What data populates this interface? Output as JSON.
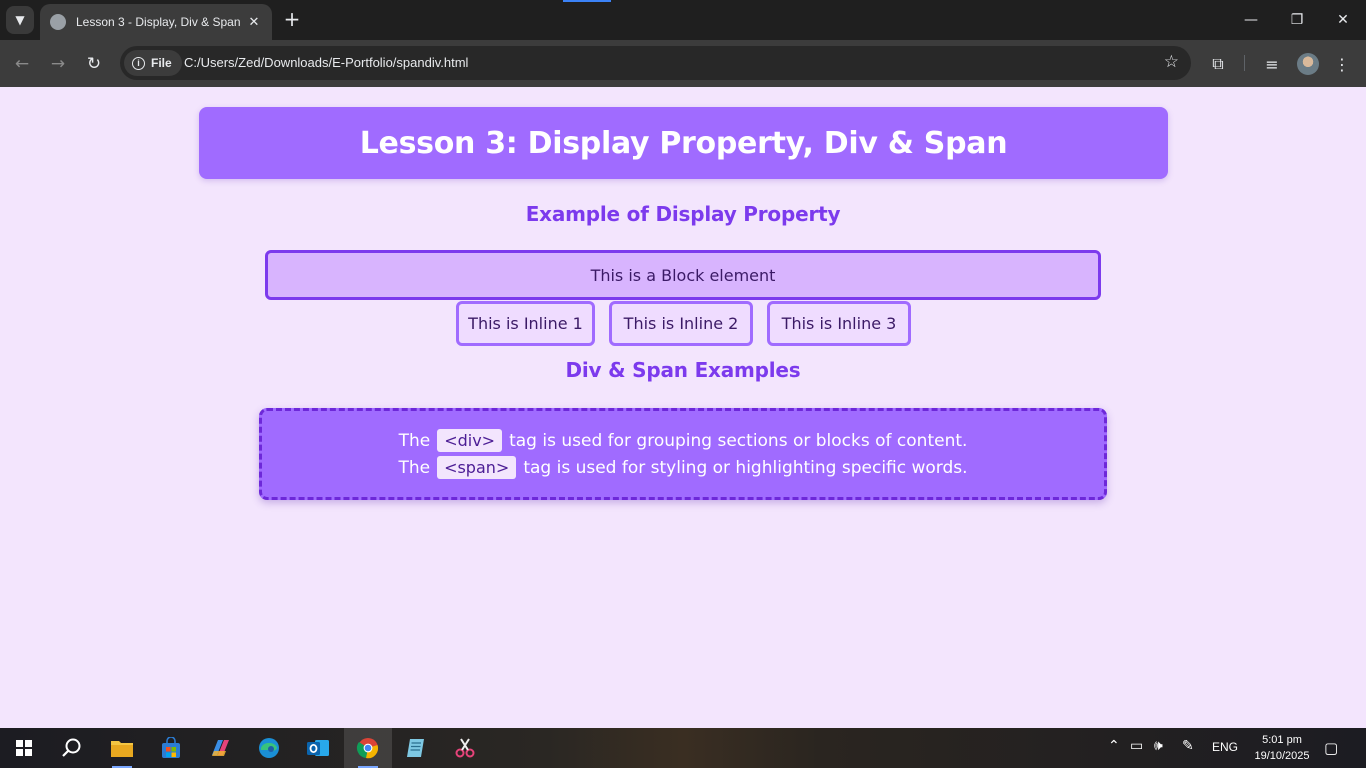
{
  "browser": {
    "tab_title": "Lesson 3 - Display, Div & Span",
    "site_chip_label": "File",
    "url": "C:/Users/Zed/Downloads/E-Portfolio/spandiv.html"
  },
  "page": {
    "title": "Lesson 3: Display Property, Div & Span",
    "section1_heading": "Example of Display Property",
    "block_element_text": "This is a Block element",
    "inline_elements": [
      "This is Inline 1",
      "This is Inline 2",
      "This is Inline 3"
    ],
    "section2_heading": "Div & Span Examples",
    "div_line": {
      "prefix": "The",
      "code": "<div>",
      "suffix": "tag is used for grouping sections or blocks of content."
    },
    "span_line": {
      "prefix": "The",
      "code": "<span>",
      "suffix": "tag is used for styling or highlighting specific words."
    }
  },
  "taskbar": {
    "apps": [
      "start",
      "search",
      "file-explorer",
      "microsoft-store",
      "copilot",
      "edge",
      "outlook",
      "chrome",
      "notepad",
      "snipping-tool"
    ],
    "language": "ENG",
    "time": "5:01 pm",
    "date": "19/10/2025"
  },
  "colors": {
    "banner": "#a06bff",
    "heading": "#7c3aed",
    "page_bg": "#f3e5fd",
    "block_bg": "#d8b4fe",
    "block_border": "#7c3aed"
  }
}
